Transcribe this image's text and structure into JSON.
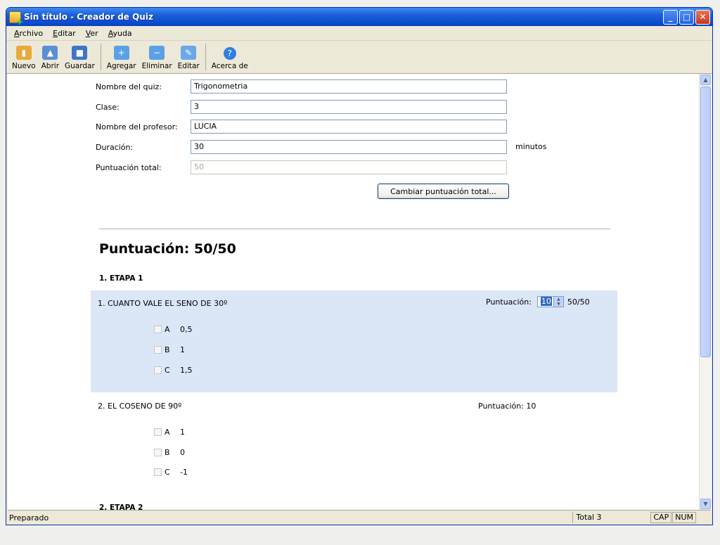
{
  "window": {
    "title": "Sin título - Creador de Quiz"
  },
  "menu": [
    "Archivo",
    "Editar",
    "Ver",
    "Ayuda"
  ],
  "toolbar": [
    {
      "label": "Nuevo",
      "icon": "new-icon",
      "color": "#e9a93c"
    },
    {
      "label": "Abrir",
      "icon": "open-folder-icon",
      "color": "#5a8fd6"
    },
    {
      "label": "Guardar",
      "icon": "save-disk-icon",
      "color": "#3e75c9"
    },
    {
      "label": "Agregar",
      "icon": "add-question-icon",
      "color": "#5aa0e6"
    },
    {
      "label": "Eliminar",
      "icon": "delete-question-icon",
      "color": "#5aa0e6"
    },
    {
      "label": "Editar",
      "icon": "edit-question-icon",
      "color": "#6ba8e8"
    },
    {
      "label": "Acerca de",
      "icon": "help-icon",
      "color": "#2f7fe0"
    }
  ],
  "form": {
    "quiz_name_label": "Nombre del quiz:",
    "quiz_name": "Trigonometria",
    "class_label": "Clase:",
    "class_value": "3",
    "teacher_label": "Nombre del profesor:",
    "teacher": "LUCIA",
    "duration_label": "Duración:",
    "duration": "30",
    "duration_unit": "minutos",
    "total_label": "Puntuación total:",
    "total": "50",
    "change_total_button": "Cambiar puntuación total..."
  },
  "score_heading": "Puntuación: 50/50",
  "stages": [
    {
      "title": "1. ETAPA 1"
    },
    {
      "title": "2. ETAPA 2"
    }
  ],
  "questions": [
    {
      "title": "1. CUANTO VALE EL SENO DE 30º",
      "points_label": "Puntuación:",
      "points": "10",
      "fraction": "50/50",
      "options": [
        {
          "letter": "A",
          "text": "0,5"
        },
        {
          "letter": "B",
          "text": "1"
        },
        {
          "letter": "C",
          "text": "1,5"
        }
      ]
    },
    {
      "title": "2. EL COSENO DE 90º",
      "points_label": "Puntuación:  10",
      "options": [
        {
          "letter": "A",
          "text": "1"
        },
        {
          "letter": "B",
          "text": "0"
        },
        {
          "letter": "C",
          "text": "-1"
        }
      ]
    }
  ],
  "status": {
    "main": "Preparado",
    "total": "Total 3",
    "cap": "CAP",
    "num": "NUM"
  }
}
